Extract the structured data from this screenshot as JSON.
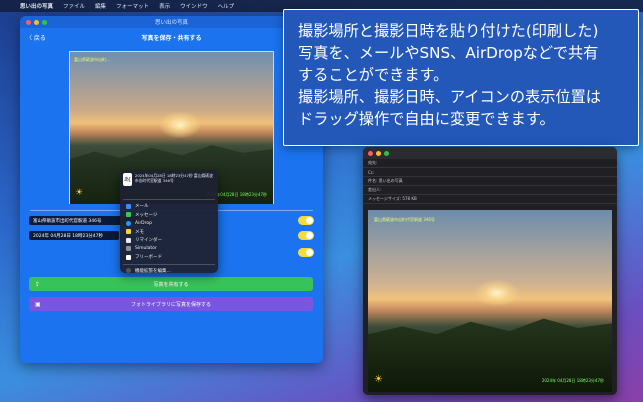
{
  "menubar": {
    "app_name": "思い出の写真",
    "items": [
      "ファイル",
      "編集",
      "フォーマット",
      "表示",
      "ウインドウ",
      "ヘルプ"
    ]
  },
  "window": {
    "title": "思い出の写真",
    "back_label": "〈 戻る",
    "nav_title": "写真を保存・共有する"
  },
  "photo": {
    "address_overlay": "富山県砺波市出町...",
    "date_overlay": "2024年04月28日 18時23分47秒"
  },
  "fields": {
    "address": "富山県砺波市出町代官駅道 346号",
    "date": "2024年 04月28日 18時23分47秒"
  },
  "share_menu": {
    "thumb_label": "あ[",
    "description": "2024年04月28日 18時23分47秒 富山県砺波市出町代官駅道 346号",
    "items": [
      "メール",
      "メッセージ",
      "AirDrop",
      "メモ",
      "リマインダー",
      "Simulator",
      "フリーボード"
    ],
    "extensions_label": "機能拡張を編集..."
  },
  "buttons": {
    "share_label": "写真を共有する",
    "save_label": "フォトライブラリに写真を保存する"
  },
  "caption": {
    "line1": "撮影場所と撮影日時を貼り付けた(印刷した)",
    "line2": "写真を、メールやSNS、AirDropなどで共有",
    "line3": "することができます。",
    "line4": "撮影場所、撮影日時、アイコンの表示位置は",
    "line5": "ドラッグ操作で自由に変更できます。"
  },
  "mail": {
    "to_label": "宛先:",
    "cc_label": "Cc:",
    "subject_label": "件名: 思い出の写真",
    "from_label": "差出人:",
    "size_label": "メッセージサイズ: 578 KB",
    "photo_address": "富山県砺波市出町代官駅道 346号",
    "photo_date": "2024年 04月28日 18時23分47秒"
  },
  "colors": {
    "window_bg": "#1b73f0",
    "share_button": "#38c35a",
    "save_button": "#7a56e0",
    "toggle": "#f6d93b"
  }
}
